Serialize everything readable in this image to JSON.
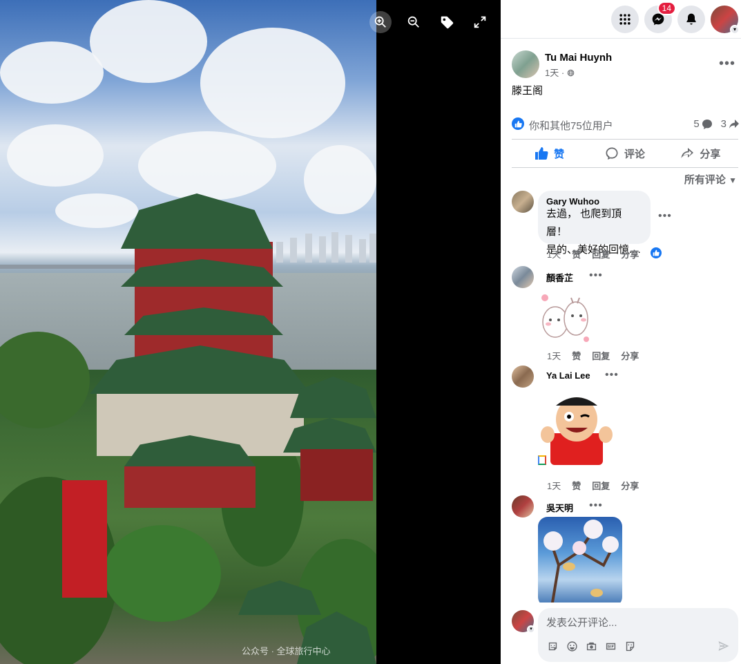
{
  "photo": {
    "watermark": "公众号 · 全球旅行中心"
  },
  "viewer_tools": {
    "zoom_in": "zoom-in-icon",
    "zoom_out": "zoom-out-icon",
    "tag": "tag-icon",
    "fullscreen": "fullscreen-icon"
  },
  "topbar": {
    "menu_icon": "grid-menu-icon",
    "messenger_icon": "messenger-icon",
    "messenger_badge": "14",
    "notifications_icon": "bell-icon",
    "account_icon": "account-avatar"
  },
  "post": {
    "author": "Tu Mai Huynh",
    "time": "1天 · ",
    "audience_icon": "globe-icon",
    "caption": "滕王阁",
    "reactions_text": "你和其他75位用户",
    "comment_count": "5",
    "share_count": "3"
  },
  "actions": {
    "like": "赞",
    "comment": "评论",
    "share": "分享"
  },
  "sort_label": "所有评论",
  "comments": [
    {
      "name": "Gary Wuhoo",
      "lines": [
        "去過， 也爬到頂層！",
        "是的、美好的回憶...."
      ],
      "time": "1天",
      "like": "赞",
      "reply": "回复",
      "share": "分享"
    },
    {
      "name": "顏香芷",
      "time": "1天",
      "like": "赞",
      "reply": "回复",
      "share": "分享"
    },
    {
      "name": "Ya Lai Lee",
      "time": "1天",
      "like": "赞",
      "reply": "回复",
      "share": "分享"
    },
    {
      "name": "吳天明"
    }
  ],
  "composer": {
    "placeholder": "发表公开评论..."
  },
  "colors": {
    "accent": "#1877f2",
    "badge": "#e41e3f",
    "secondary_text": "#65676b"
  }
}
